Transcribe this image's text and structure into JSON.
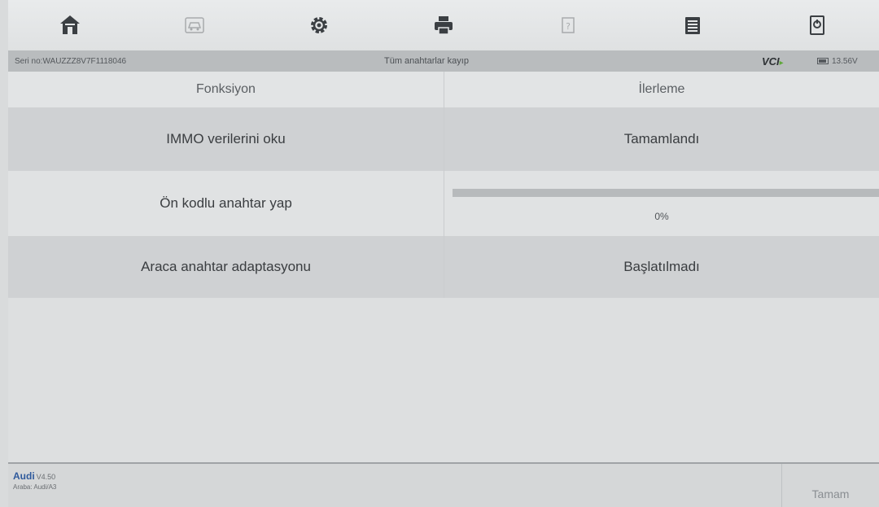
{
  "toolbar": {
    "items": [
      {
        "icon": "home-icon"
      },
      {
        "icon": "vehicle-icon"
      },
      {
        "icon": "settings-gear-icon"
      },
      {
        "icon": "print-icon"
      },
      {
        "icon": "help-icon"
      },
      {
        "icon": "data-log-icon"
      },
      {
        "icon": "exit-icon"
      }
    ]
  },
  "status": {
    "vin": "Seri no:WAUZZZ8V7F1118046",
    "mode_title": "Tüm anahtarlar kayıp",
    "vci_label": "VCI",
    "voltage": "13.56V"
  },
  "table": {
    "headers": {
      "function": "Fonksiyon",
      "progress": "İlerleme"
    },
    "rows": [
      {
        "function": "IMMO verilerini oku",
        "status": "Tamamlandı"
      },
      {
        "function": "Ön kodlu anahtar yap",
        "progress_text": "0%",
        "progress_fraction": 0
      },
      {
        "function": "Araca anahtar adaptasyonu",
        "status": "Başlatılmadı"
      }
    ]
  },
  "footer": {
    "brand": "Audi",
    "version": "V4.50",
    "vehicle": "Araba: Audi/A3",
    "ok_label": "Tamam"
  }
}
